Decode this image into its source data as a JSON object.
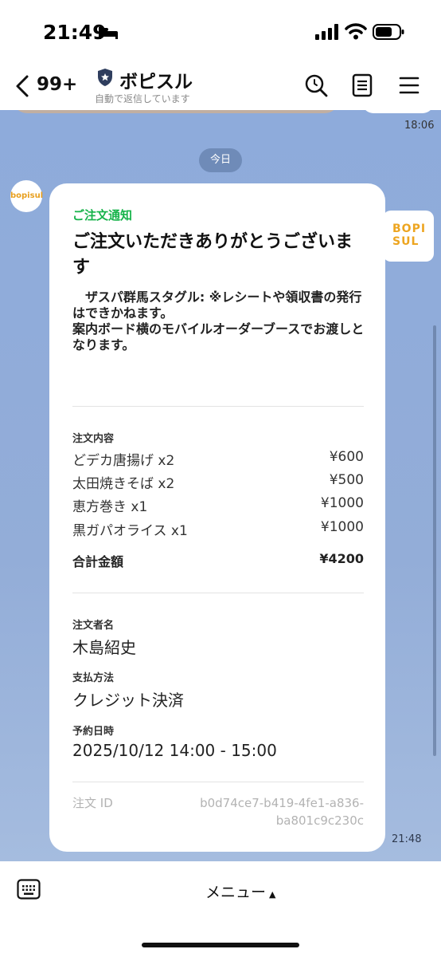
{
  "status_bar": {
    "time": "21:49"
  },
  "nav": {
    "unread_count": "99+",
    "title": "ボピスル",
    "subtitle": "自動で返信しています"
  },
  "chat": {
    "previous_time": "18:06",
    "date_chip": "今日",
    "avatar_text": "bopisul",
    "side_logo_line1": "BOPI",
    "side_logo_line2": "SUL",
    "message_time": "21:48"
  },
  "message": {
    "notification_label": "ご注文通知",
    "title": "ご注文いただきありがとうございます",
    "notice": "　ザスパ群馬スタグル: ※レシートや領収書の発行はできかねます。\n案内ボード横のモバイルオーダーブースでお渡しとなります。",
    "order_section_label": "注文内容",
    "items": [
      {
        "name": "どデカ唐揚げ x2",
        "price": "¥600"
      },
      {
        "name": "太田焼きそば x2",
        "price": "¥500"
      },
      {
        "name": "恵方巻き x1",
        "price": "¥1000"
      },
      {
        "name": "黒ガパオライス x1",
        "price": "¥1000"
      }
    ],
    "total_label": "合計金額",
    "total_value": "¥4200",
    "orderer_label": "注文者名",
    "orderer_value": "木島紹史",
    "payment_label": "支払方法",
    "payment_value": "クレジット決済",
    "reservation_label": "予約日時",
    "reservation_value": "2025/10/12 14:00 - 15:00",
    "order_id_label": "注文 ID",
    "order_id_value": "b0d74ce7-b419-4fe1-a836-ba801c9c230c"
  },
  "bottom": {
    "menu_label": "メニュー"
  },
  "colors": {
    "accent_green": "#16b34a",
    "chat_bg": "#8fa8d6",
    "logo_orange": "#eda520"
  }
}
